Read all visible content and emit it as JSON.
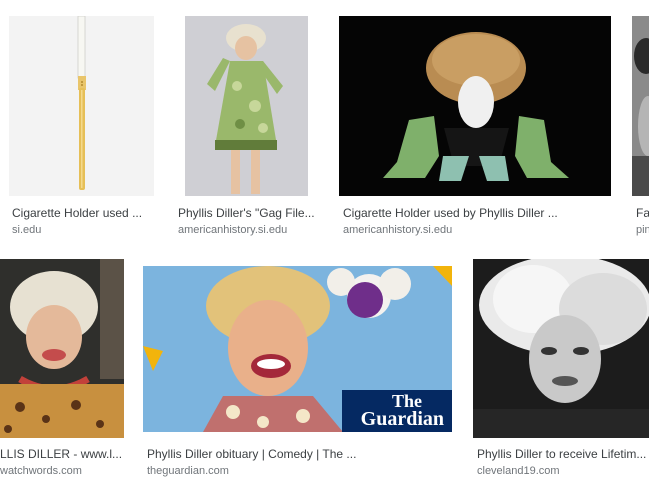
{
  "results": [
    {
      "title": "Cigarette Holder used ...",
      "source": "si.edu"
    },
    {
      "title": "Phyllis Diller's \"Gag File...",
      "source": "americanhistory.si.edu"
    },
    {
      "title": "Cigarette Holder used by Phyllis Diller ...",
      "source": "americanhistory.si.edu"
    },
    {
      "title": "Fa",
      "source": "pin"
    },
    {
      "title": "LLIS DILLER - www.l...",
      "source": "watchwords.com"
    },
    {
      "title": "Phyllis Diller obituary | Comedy | The ...",
      "source": "theguardian.com"
    },
    {
      "title": "Phyllis Diller to receive Lifetim...",
      "source": "cleveland19.com"
    }
  ],
  "watermark": {
    "line1": "The",
    "line2": "Guardian"
  },
  "colors": {
    "guardian_blue": "#052962",
    "caption_gray": "#70757a"
  }
}
